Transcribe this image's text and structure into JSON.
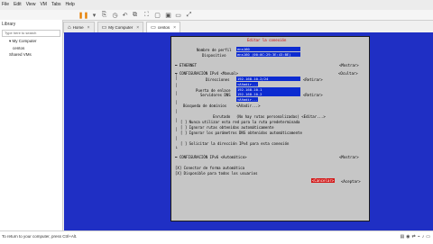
{
  "menu": [
    "File",
    "Edit",
    "View",
    "VM",
    "Tabs",
    "Help"
  ],
  "library": {
    "title": "Library",
    "search_placeholder": "Type here to search",
    "items": [
      {
        "label": "My Computer"
      },
      {
        "label": "centos"
      },
      {
        "label": "Shared VMs"
      }
    ]
  },
  "tabs": [
    {
      "label": "Home"
    },
    {
      "label": "My Computer"
    },
    {
      "label": "centos"
    }
  ],
  "dialog": {
    "title": "Editar la conexión",
    "profile_label": "Nombre de perfil",
    "profile_value": "ens160",
    "device_label": "Dispositivo",
    "device_value": "ens160 (00:0C:29:3E:43:BE)",
    "ethernet_label": "ETHERNET",
    "show_label": "<Mostrar>",
    "ipv4_header": "CONFIGURACIÓN IPv4",
    "ipv4_mode": "<Manual>",
    "hide_label": "<Ocultar>",
    "addresses_label": "Direcciones",
    "addresses_value": "192.168.10.2/24",
    "remove_label": "<Retirar>",
    "add_label": "<Añadir...>",
    "gateway_label": "Puerta de enlace",
    "gateway_value": "192.168.10.1",
    "dns_label": "Servidores DNS",
    "dns_value": "192.168.10.2",
    "dns_add": "<Añadir...>",
    "search_domains_label": "Búsqueda de dominios",
    "search_domains_add": "<Añadir...>",
    "routing_label": "Enrutado",
    "routing_value": "(No hay rutas personalizadas) <Editar...>",
    "opt1": "[ ] Nunca utilizar esta red para la ruta predeterminada",
    "opt2": "[ ] Ignorar rutas obtenidas automáticamente",
    "opt3": "[ ] Ignorar los parámetros DNS obtenidos automáticamente",
    "opt4": "[ ] Solicitar la dirección IPv4 para esta conexión",
    "ipv6_header": "CONFIGURACIÓN IPv6",
    "ipv6_mode": "<Automático>",
    "auto_connect": "[X] Conectar de forma automática",
    "all_users": "[X] Disponible para todos los usuarios",
    "cancel_label": "<Cancelar>",
    "accept_label": "<Aceptar>"
  },
  "status_text": "To return to your computer, press Ctrl+Alt.",
  "colors": {
    "vm_bg": "#1f2fc4",
    "dialog_bg": "#c6c6c6",
    "field_bg": "#0c2bd1",
    "accent_red": "#d21a1a"
  }
}
